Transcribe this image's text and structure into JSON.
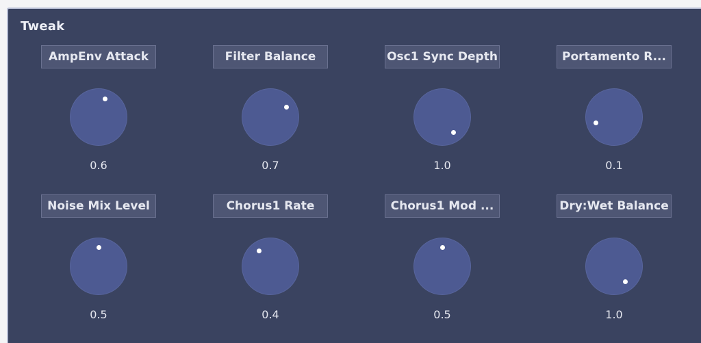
{
  "panel": {
    "title": "Tweak"
  },
  "knobs": [
    {
      "label": "AmpEnv Attack",
      "value_text": "0.6",
      "dot_angle_deg": 20
    },
    {
      "label": "Filter Balance",
      "value_text": "0.7",
      "dot_angle_deg": 58
    },
    {
      "label": "Osc1 Sync Depth",
      "value_text": "1.0",
      "dot_angle_deg": 145
    },
    {
      "label": "Portamento R...",
      "value_text": "0.1",
      "dot_angle_deg": 253
    },
    {
      "label": "Noise Mix Level",
      "value_text": "0.5",
      "dot_angle_deg": 0
    },
    {
      "label": "Chorus1 Rate",
      "value_text": "0.4",
      "dot_angle_deg": 325
    },
    {
      "label": "Chorus1 Mod ...",
      "value_text": "0.5",
      "dot_angle_deg": 0
    },
    {
      "label": "Dry:Wet Balance",
      "value_text": "1.0",
      "dot_angle_deg": 145
    }
  ],
  "colors": {
    "panel_bg": "#3a4360",
    "knob_fill": "#4d5a92",
    "label_bg": "#4e5674",
    "dot": "#ffffff"
  }
}
